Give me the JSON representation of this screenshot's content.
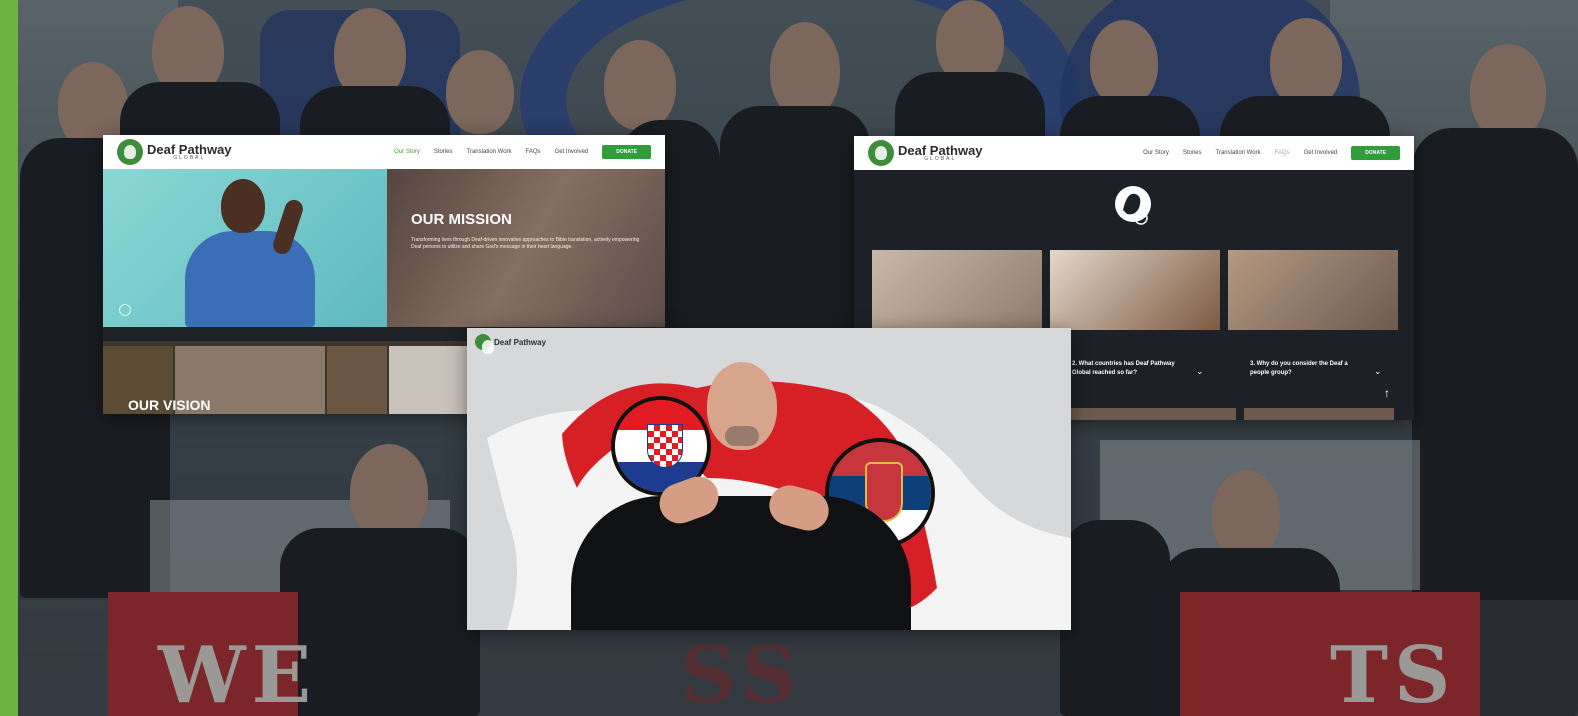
{
  "brand": {
    "name": "Deaf Pathway",
    "subtitle": "GLOBAL",
    "green": "#6cb33f",
    "button_green": "#2f9d3a"
  },
  "mission_page": {
    "nav": [
      "Our Story",
      "Stories",
      "Translation Work",
      "FAQs",
      "Get Involved"
    ],
    "active_nav": "Our Story",
    "donate_label": "DONATE",
    "mission_title": "OUR MISSION",
    "mission_text": "Transforming lives through Deaf-driven innovative approaches to Bible translation, actively empowering Deaf persons to utilize and share God's message in their heart language.",
    "vision_title": "OUR VISION"
  },
  "faq_page": {
    "nav": [
      "Our Story",
      "Stories",
      "Translation Work",
      "FAQs",
      "Get Involved"
    ],
    "donate_label": "DONATE",
    "questions": [
      "2. What countries has Deaf Pathway Global reached so far?",
      "3. Why do you consider the Deaf a people group?"
    ]
  },
  "video_frame": {
    "brand_name": "Deaf Pathway",
    "flags": [
      "croatia-flag",
      "serbia-flag"
    ]
  },
  "background_banner": {
    "left_text": "WE",
    "mid_text": "SS",
    "right_text": "TS"
  }
}
